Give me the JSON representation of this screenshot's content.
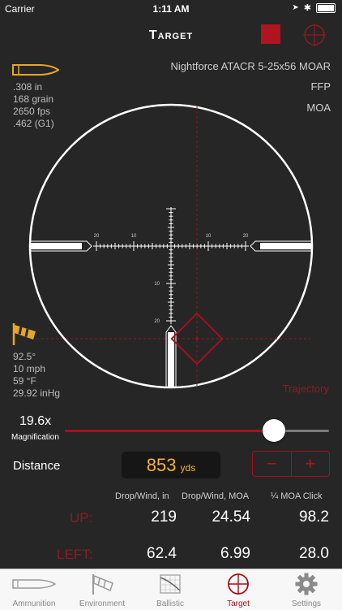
{
  "status": {
    "carrier": "Carrier",
    "time": "1:11 AM"
  },
  "nav": {
    "title": "Target"
  },
  "ammo": {
    "caliber": ".308 in",
    "weight": "168 grain",
    "velocity": "2650 fps",
    "bc": ".462 (G1)"
  },
  "scope": {
    "name": "Nightforce ATACR 5-25x56 MOAR",
    "plane": "FFP",
    "units": "MOA"
  },
  "reticle": {
    "h_labels": [
      "20",
      "10",
      "10",
      "20"
    ],
    "v_labels": [
      "10",
      "20"
    ]
  },
  "environment": {
    "wind_dir": "92.5°",
    "wind_speed": "10 mph",
    "temperature": "59 °F",
    "pressure": "29.92 inHg"
  },
  "trajectory_label": "Trajectory",
  "magnification": {
    "value": "19.6x",
    "label": "Magnification",
    "level": 0.79
  },
  "distance": {
    "label": "Distance",
    "value": "853",
    "unit": "yds",
    "minus": "−",
    "plus": "+"
  },
  "results": {
    "headers": [
      "Drop/Wind, in",
      "Drop/Wind, MOA",
      "¼ MOA Click"
    ],
    "rows": [
      {
        "label": "UP:",
        "inches": "219",
        "moa": "24.54",
        "clicks": "98.2"
      },
      {
        "label": "LEFT:",
        "inches": "62.4",
        "moa": "6.99",
        "clicks": "28.0"
      }
    ]
  },
  "tabs": [
    {
      "label": "Ammunition",
      "icon": "bullet-icon"
    },
    {
      "label": "Environment",
      "icon": "windsock-icon"
    },
    {
      "label": "Ballistic",
      "icon": "ballistic-chart-icon"
    },
    {
      "label": "Target",
      "icon": "crosshair-icon"
    },
    {
      "label": "Settings",
      "icon": "gear-icon"
    }
  ],
  "colors": {
    "accent": "#a0121c",
    "distance": "#f3b331",
    "ammo_icon": "#e3a62a",
    "background": "#262626"
  }
}
